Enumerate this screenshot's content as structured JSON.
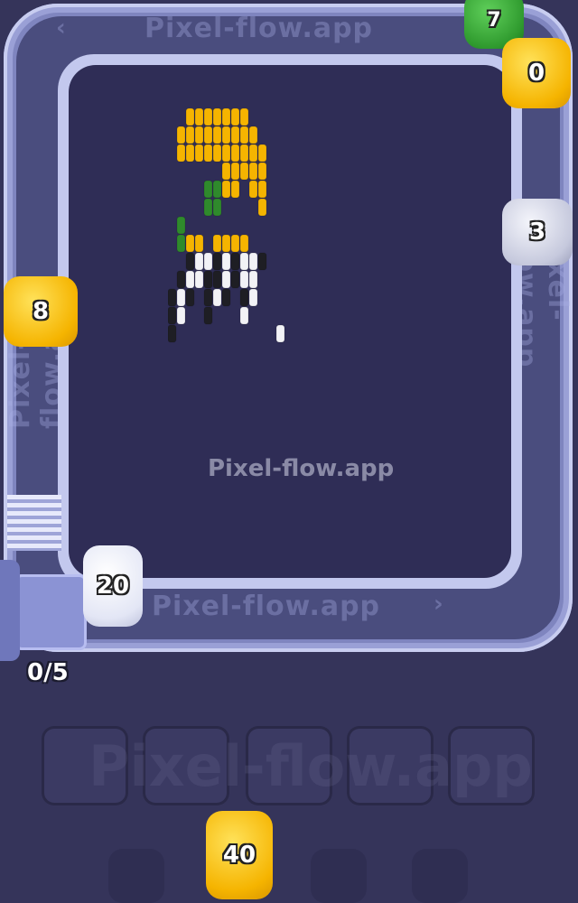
{
  "watermark": "Pixel-flow.app",
  "belt": {
    "top_text": "Pixel-flow.app",
    "bottom_text": "Pixel-flow.app",
    "left_text": "Pixel-flow.app",
    "right_text": "Pixel-flow.app",
    "slot_text": "Pixel-flow.app"
  },
  "progress": {
    "label": "0/5"
  },
  "shooters": [
    {
      "id": "yellow-top-right",
      "count": "0",
      "color": "yellow"
    },
    {
      "id": "green-top",
      "count": "7",
      "color": "green"
    },
    {
      "id": "silver-right",
      "count": "3",
      "color": "silver"
    },
    {
      "id": "yellow-left",
      "count": "8",
      "color": "yellow"
    },
    {
      "id": "white-bottom",
      "count": "20",
      "color": "white"
    },
    {
      "id": "yellow-queue",
      "count": "40",
      "color": "yellow"
    }
  ],
  "slots": {
    "count": 5
  },
  "colors": {
    "yellow": "#f5b400",
    "green": "#2f8a2c",
    "white": "#f2f2f6",
    "black": "#1e1e24",
    "gray": "#9a9aa8"
  },
  "pixel_art": {
    "rows": [
      "..YYYYYYY....",
      ".YYYYYYYYY...",
      ".YYYYYYYYYY..",
      "......YYYYY..",
      "....GGYY.YY..",
      "....GG....Y..",
      ".G...........",
      ".GYY.YYYY....",
      "..KWWKWKWWK..",
      ".KWWKKWKWW...",
      "KWK.KWK.KW...",
      "KW..K...W....",
      "K...........W"
    ],
    "legend": {
      "Y": "yellow",
      "G": "green",
      "W": "white",
      "K": "black"
    }
  }
}
